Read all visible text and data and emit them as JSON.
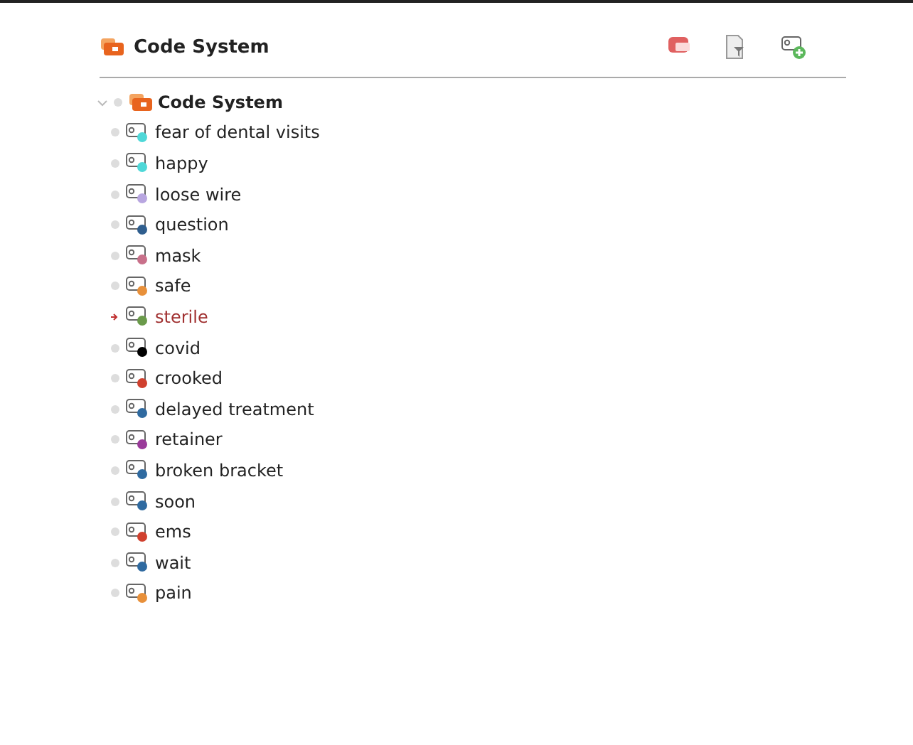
{
  "header": {
    "title": "Code System"
  },
  "tree": {
    "label": "Code System",
    "expanded": true,
    "children": [
      {
        "label": "fear of dental visits",
        "color": "#4fd8d8",
        "selected": false
      },
      {
        "label": "happy",
        "color": "#4fd8d8",
        "selected": false
      },
      {
        "label": "loose wire",
        "color": "#b8a6e0",
        "selected": false
      },
      {
        "label": "question",
        "color": "#2f5e8e",
        "selected": false
      },
      {
        "label": "mask",
        "color": "#c8708a",
        "selected": false
      },
      {
        "label": "safe",
        "color": "#e8903a",
        "selected": false
      },
      {
        "label": "sterile",
        "color": "#6a9a4a",
        "selected": true
      },
      {
        "label": "covid",
        "color": "#000000",
        "selected": false
      },
      {
        "label": "crooked",
        "color": "#d0402e",
        "selected": false
      },
      {
        "label": "delayed treatment",
        "color": "#2f6aa0",
        "selected": false
      },
      {
        "label": "retainer",
        "color": "#9a3a9a",
        "selected": false
      },
      {
        "label": "broken bracket",
        "color": "#2f6aa0",
        "selected": false
      },
      {
        "label": "soon",
        "color": "#2f6aa0",
        "selected": false
      },
      {
        "label": "ems",
        "color": "#d0402e",
        "selected": false
      },
      {
        "label": "wait",
        "color": "#2f6aa0",
        "selected": false
      },
      {
        "label": "pain",
        "color": "#e8903a",
        "selected": false
      }
    ]
  }
}
